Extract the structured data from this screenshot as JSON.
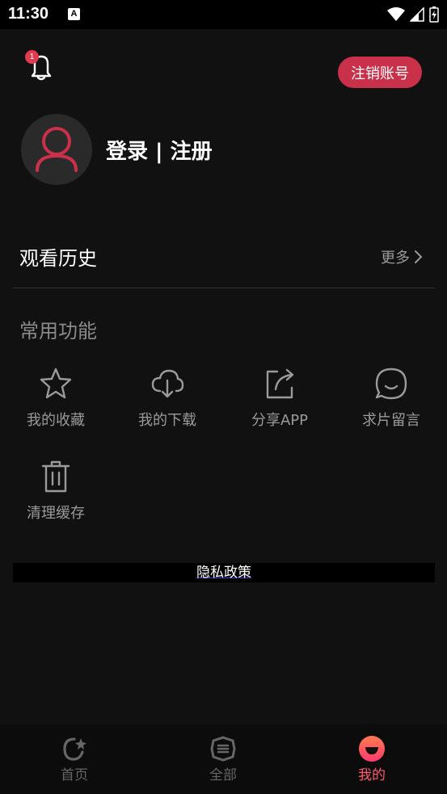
{
  "status_bar": {
    "time": "11:30",
    "a_icon": "A"
  },
  "header": {
    "notification_count": "1",
    "cancel_account_label": "注销账号"
  },
  "profile": {
    "login_label": "登录 | 注册"
  },
  "history": {
    "title": "观看历史",
    "more_label": "更多"
  },
  "features": {
    "title": "常用功能",
    "items": [
      {
        "label": "我的收藏",
        "icon": "star-icon"
      },
      {
        "label": "我的下载",
        "icon": "cloud-download-icon"
      },
      {
        "label": "分享APP",
        "icon": "share-icon"
      },
      {
        "label": "求片留言",
        "icon": "chat-icon"
      },
      {
        "label": "清理缓存",
        "icon": "trash-icon"
      }
    ]
  },
  "privacy": {
    "label": "隐私政策"
  },
  "bottom_nav": {
    "items": [
      {
        "label": "首页",
        "icon": "home-icon",
        "active": false
      },
      {
        "label": "全部",
        "icon": "all-icon",
        "active": false
      },
      {
        "label": "我的",
        "icon": "profile-icon",
        "active": true
      }
    ]
  },
  "colors": {
    "background": "#111111",
    "accent": "#c9304a",
    "active_nav": "#ff5a6e",
    "muted_text": "#9a9a9a"
  }
}
